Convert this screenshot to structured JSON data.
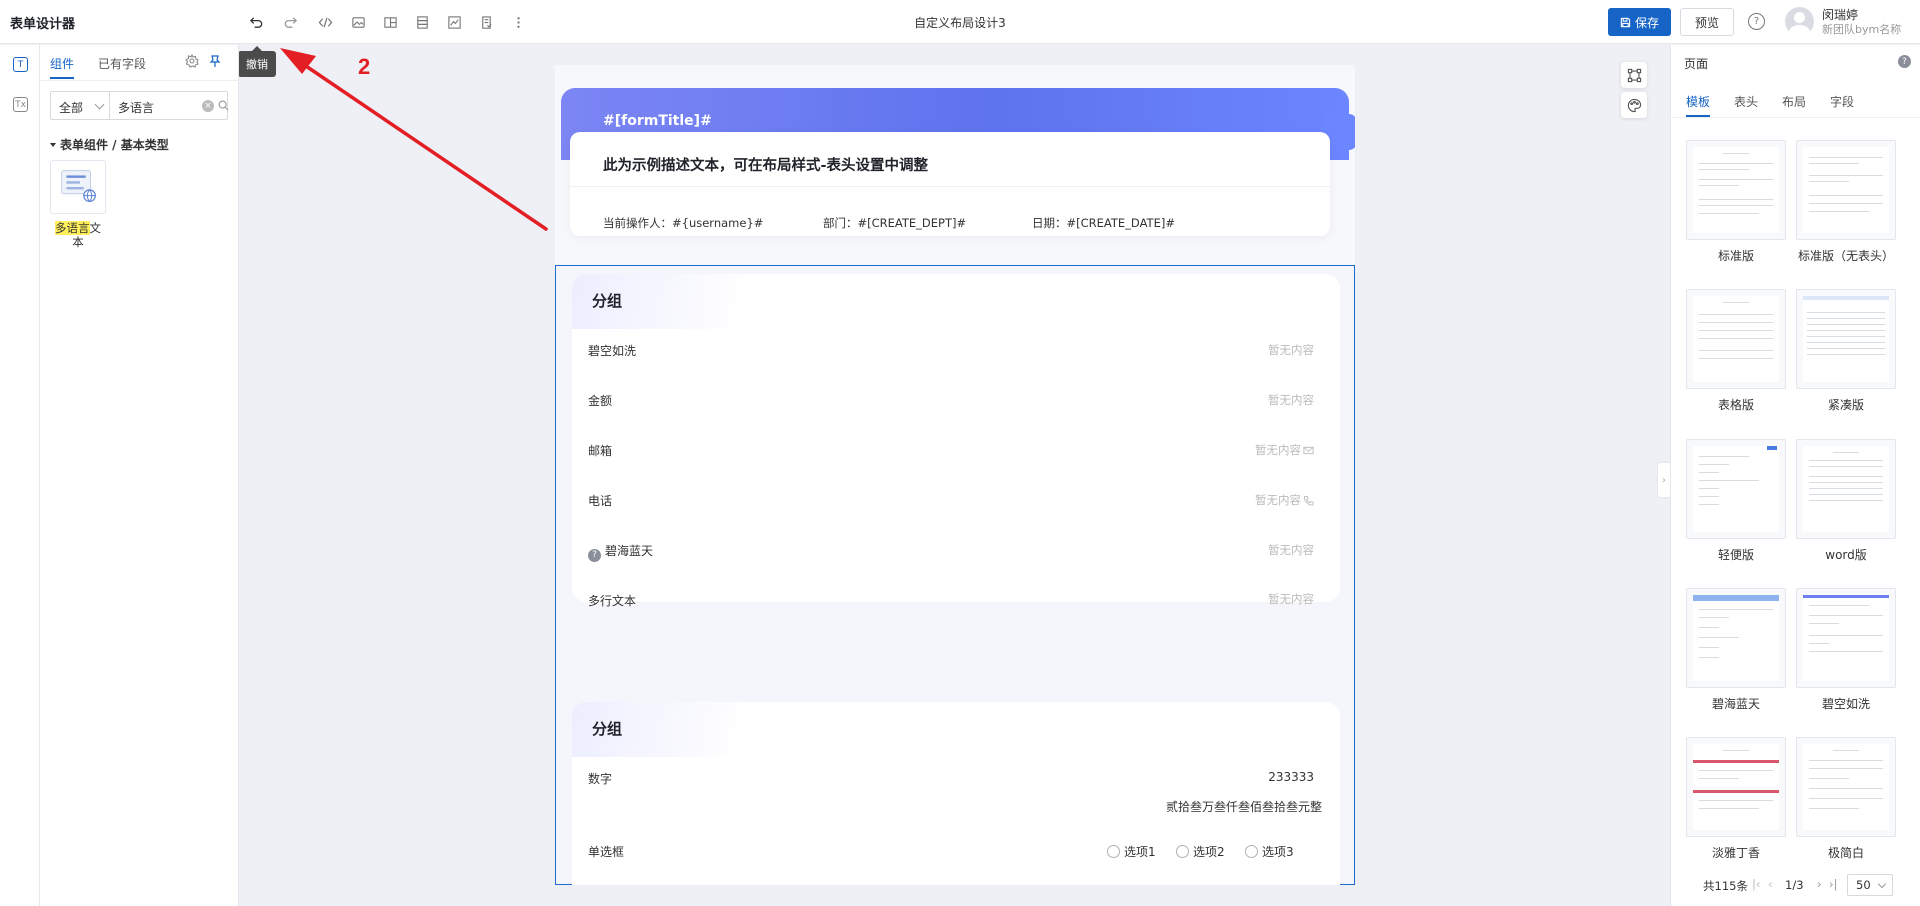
{
  "app": {
    "title": "表单设计器",
    "doc_title": "自定义布局设计3"
  },
  "toolbar": {
    "tooltip": "撤销",
    "icons": [
      "undo-icon",
      "redo-icon",
      "code-icon",
      "image-icon",
      "layout-icon",
      "stack-icon",
      "chart-icon",
      "book-icon",
      "more-icon"
    ]
  },
  "actions": {
    "save_label": "保存",
    "preview_label": "预览"
  },
  "user": {
    "name": "闵瑞婷",
    "team": "新团队bym名称"
  },
  "left_panel": {
    "tabs": [
      "组件",
      "已有字段"
    ],
    "filter_select": "全部",
    "filter_value": "多语言",
    "tree_title": "表单组件 / 基本类型",
    "component_label_highlight": "多语言",
    "component_label_rest": "文本"
  },
  "canvas": {
    "form_title": "#[formTitle]#",
    "description": "此为示例描述文本，可在布局样式-表头设置中调整",
    "meta": [
      "当前操作人：#{username}#",
      "部门：#[CREATE_DEPT]#",
      "日期：#[CREATE_DATE]#"
    ],
    "groups": [
      {
        "title": "分组",
        "fields": [
          {
            "label": "碧空如洗",
            "value": "暂无内容"
          },
          {
            "label": "金额",
            "value": "暂无内容"
          },
          {
            "label": "邮箱",
            "value": "暂无内容"
          },
          {
            "label": "电话",
            "value": "暂无内容"
          },
          {
            "label": "碧海蓝天",
            "value": "暂无内容"
          },
          {
            "label": "多行文本",
            "value": "暂无内容"
          }
        ]
      },
      {
        "title": "分组",
        "number_label": "数字",
        "number_value": "233333",
        "amount_text": "贰拾叁万叁仟叁佰叁拾叁元整",
        "radio_label": "单选框",
        "radio_options": [
          "选项1",
          "选项2",
          "选项3"
        ]
      }
    ]
  },
  "right_panel": {
    "title": "页面",
    "tabs": [
      "模板",
      "表头",
      "布局",
      "字段"
    ],
    "templates": [
      "标准版",
      "标准版（无表头）",
      "表格版",
      "紧凑版",
      "轻便版",
      "word版",
      "碧海蓝天",
      "碧空如洗",
      "淡雅丁香",
      "极简白"
    ],
    "pager_total": "共115条",
    "pager_page": "1/3",
    "page_size": "50"
  },
  "annotation": {
    "number": "2",
    "color": "#e31e24"
  },
  "colors": {
    "accent": "#1664c6",
    "header_gradient": "#5e73ee"
  }
}
